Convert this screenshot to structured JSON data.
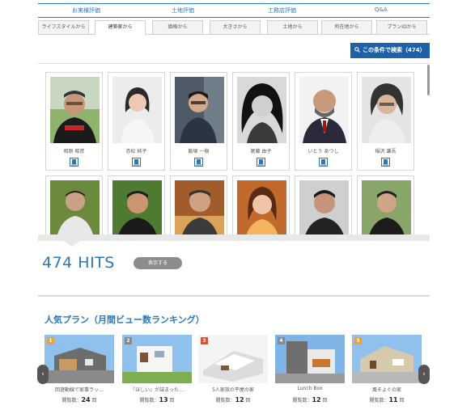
{
  "nav": {
    "items": [
      "お実様評価",
      "土地評価",
      "工務店評価",
      "Q&A"
    ]
  },
  "tabs": [
    {
      "label": "ライフスタイルから",
      "active": false
    },
    {
      "label": "建築家から",
      "active": true
    },
    {
      "label": "価格から",
      "active": false
    },
    {
      "label": "大きさから",
      "active": false
    },
    {
      "label": "土地から",
      "active": false
    },
    {
      "label": "所在地から",
      "active": false
    },
    {
      "label": "プランIDから",
      "active": false
    }
  ],
  "search": {
    "label": "この条件で検索（474）"
  },
  "architects": [
    {
      "name": "相原 昭彦"
    },
    {
      "name": "赤松 純子"
    },
    {
      "name": "飯塚 一樹"
    },
    {
      "name": "尾藤 由子"
    },
    {
      "name": "いとう あつし"
    },
    {
      "name": "稲沢 謙吾"
    }
  ],
  "results": {
    "hits": "474 HITS",
    "show_label": "表示する"
  },
  "ranking": {
    "title": "人気プラン（月間ビュー数ランキング）",
    "views_prefix": "閲覧数：",
    "views_unit": "回",
    "plans": [
      {
        "rank": "1",
        "title": "回遊動線で家事ラッ…",
        "views": "24"
      },
      {
        "rank": "2",
        "title": "『ほしい』が詰まった…",
        "views": "13"
      },
      {
        "rank": "3",
        "title": "5人家族の平屋の家",
        "views": "12"
      },
      {
        "rank": "4",
        "title": "Lunch Box",
        "views": "12"
      },
      {
        "rank": "5",
        "title": "風そよぐの家",
        "views": "11"
      }
    ],
    "prev_icon": "chevron-left-icon",
    "next_icon": "chevron-right-icon"
  },
  "colors": {
    "accent": "#2a78b8",
    "button": "#1d62a8",
    "rank_badge": "#e8a23a"
  }
}
